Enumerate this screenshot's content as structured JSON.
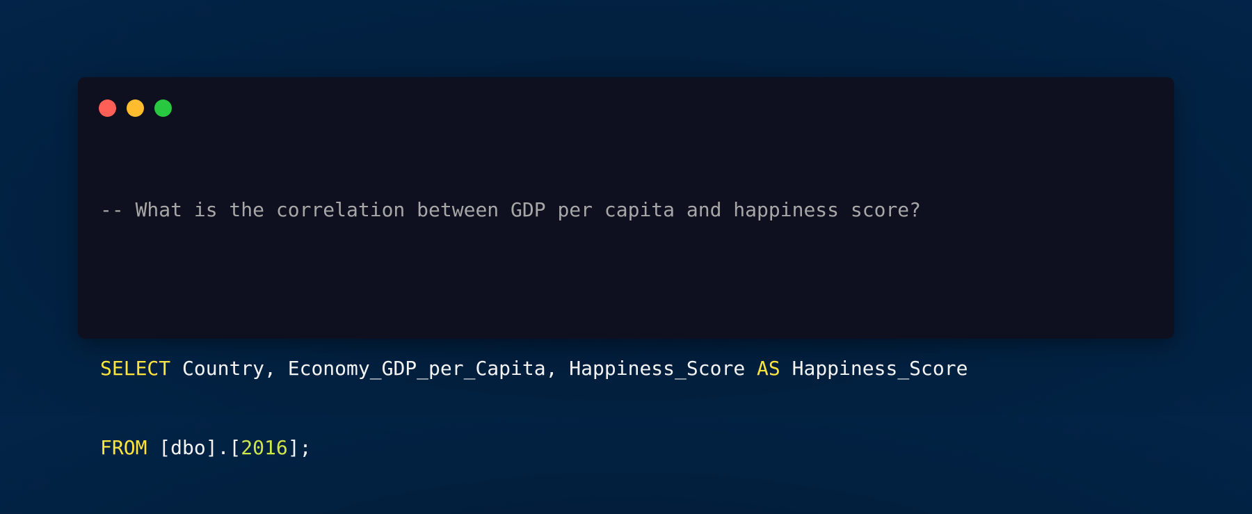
{
  "window": {
    "traffic_lights": [
      {
        "name": "close-dot",
        "color": "#ff5f57"
      },
      {
        "name": "minimize-dot",
        "color": "#febc2e"
      },
      {
        "name": "maximize-dot",
        "color": "#28c840"
      }
    ]
  },
  "code": {
    "comment": "-- What is the correlation between GDP per capita and happiness score?",
    "line1": {
      "kw_select": "SELECT",
      "columns": " Country, Economy_GDP_per_Capita, Happiness_Score ",
      "kw_as": "AS",
      "alias": " Happiness_Score"
    },
    "line2": {
      "kw_from": "FROM",
      "table_prefix": " [dbo].[",
      "table_number": "2016",
      "table_suffix": "];"
    }
  },
  "colors": {
    "keyword": "#ffe53b",
    "number": "#cfe64a",
    "comment": "#a7a7a7",
    "window_bg": "#0e101f"
  }
}
